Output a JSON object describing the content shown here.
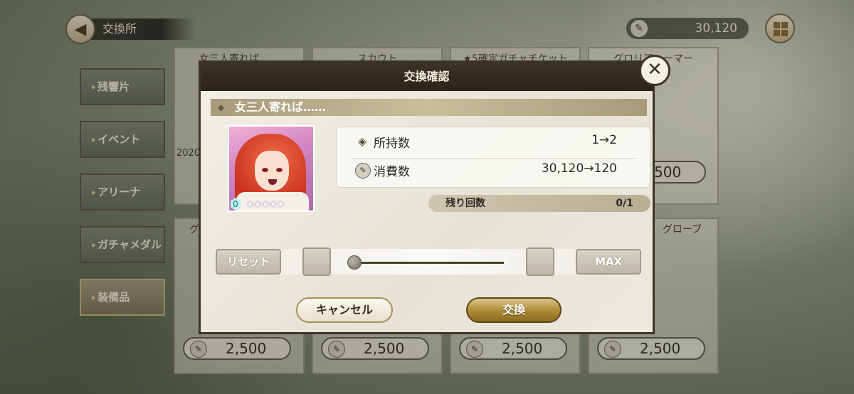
{
  "header": {
    "title": "交換所",
    "currency_value": "30,120"
  },
  "sidebar": {
    "items": [
      {
        "label": "残響片"
      },
      {
        "label": "イベント"
      },
      {
        "label": "アリーナ"
      },
      {
        "label": "ガチャメダル"
      },
      {
        "label": "装備品",
        "active": true
      }
    ]
  },
  "background_cards": {
    "top_titles": [
      "女三人寄れば……",
      "スカウト",
      "★5確定ガチャチケット",
      "グロリア…ーマー"
    ],
    "partial_text": "2020",
    "top_right_price": "2,500",
    "bottom_left_title": "グ",
    "bottom_right_title": "グローブ",
    "bottom_prices": [
      "2,500",
      "2,500",
      "2,500",
      "2,500"
    ]
  },
  "dialog": {
    "title": "交換確認",
    "item_name": "女三人寄れば……",
    "level": "0",
    "stars": "★★★★★",
    "owned_label": "所持数",
    "owned_value": "1→2",
    "cost_label": "消費数",
    "cost_value": "30,120→120",
    "remaining_label": "残り回数",
    "remaining_value": "0/1",
    "reset_label": "リセット",
    "max_label": "MAX",
    "cancel_label": "キャンセル",
    "exchange_label": "交換",
    "slider_fraction": 0
  },
  "icons": {
    "back": "arrow-left-icon",
    "currency": "wrench-coin-icon",
    "menu": "grid-menu-icon",
    "close": "close-icon"
  },
  "colors": {
    "dialog_header": "#2f281e",
    "exchange_gold": "#a98832",
    "panel_bg": "#eeebe2"
  }
}
